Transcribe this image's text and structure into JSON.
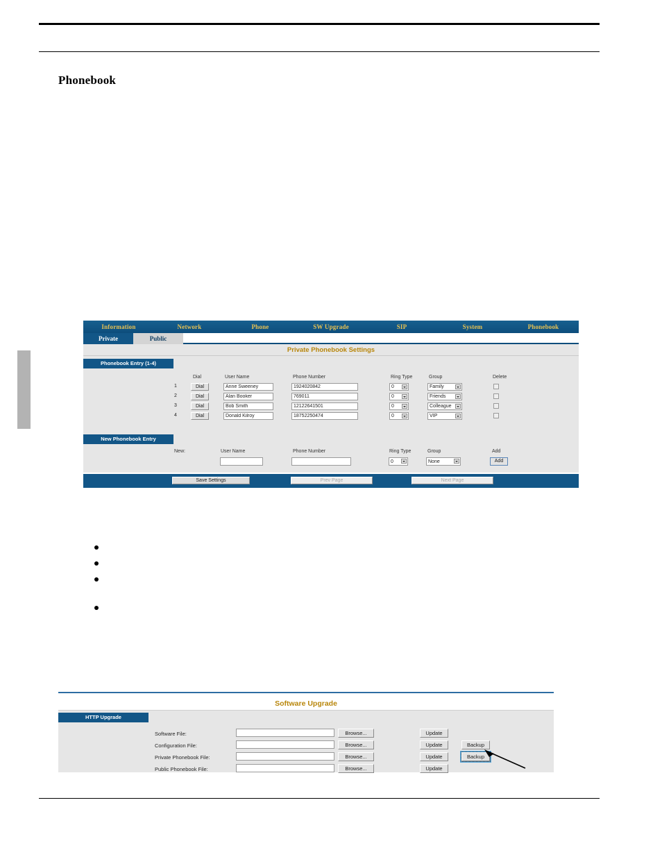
{
  "document": {
    "page_heading": "Phonebook",
    "bullets": [
      "",
      "",
      "",
      ""
    ]
  },
  "phonebook_screenshot": {
    "nav": [
      {
        "label": "Information"
      },
      {
        "label": "Network"
      },
      {
        "label": "Phone"
      },
      {
        "label": "SW Upgrade"
      },
      {
        "label": "SIP"
      },
      {
        "label": "System"
      },
      {
        "label": "Phonebook"
      }
    ],
    "tabs": [
      {
        "label": "Private",
        "active": true
      },
      {
        "label": "Public",
        "active": false
      }
    ],
    "section_title": "Private Phonebook Settings",
    "entry_group_label": "Phonebook Entry (1-4)",
    "columns": {
      "dial": "Dial",
      "user_name": "User Name",
      "phone_number": "Phone Number",
      "ring_type": "Ring Type",
      "group": "Group",
      "delete": "Delete"
    },
    "dial_button_label": "Dial",
    "rows": [
      {
        "index": "1",
        "user_name": "Anne Sweeney",
        "phone_number": "1924020842",
        "ring_type": "0",
        "group": "Family"
      },
      {
        "index": "2",
        "user_name": "Alan Booker",
        "phone_number": "769011",
        "ring_type": "0",
        "group": "Friends"
      },
      {
        "index": "3",
        "user_name": "Bob Smith",
        "phone_number": "12122641501",
        "ring_type": "0",
        "group": "Colleague"
      },
      {
        "index": "4",
        "user_name": "Donald Kilroy",
        "phone_number": "18752250474",
        "ring_type": "0",
        "group": "VIP"
      }
    ],
    "new_entry": {
      "group_label": "New Phonebook Entry",
      "new_label": "New:",
      "user_name_label": "User Name",
      "phone_number_label": "Phone Number",
      "ring_type_label": "Ring Type",
      "group_label_col": "Group",
      "add_label": "Add",
      "user_name_value": "",
      "phone_number_value": "",
      "ring_type_value": "0",
      "group_value": "None",
      "add_button_label": "Add"
    },
    "footer": {
      "save": "Save Settings",
      "prev": "Prev Page",
      "next": "Next Page"
    },
    "colors": {
      "nav_blue": "#125687",
      "nav_text_gold": "#e8c252",
      "panel_gray": "#e6e6e6",
      "title_gold": "#b8860b"
    }
  },
  "upgrade_screenshot": {
    "section_title": "Software Upgrade",
    "group_label": "HTTP Upgrade",
    "browse_label": "Browse...",
    "update_label": "Update",
    "backup_label": "Backup",
    "rows": [
      {
        "label": "Software File:",
        "value": "",
        "has_backup": false
      },
      {
        "label": "Configuration File:",
        "value": "",
        "has_backup": true
      },
      {
        "label": "Private Phonebook File:",
        "value": "",
        "has_backup": true,
        "backup_focused": true
      },
      {
        "label": "Public Phonebook File:",
        "value": "",
        "has_backup": false
      }
    ],
    "annotation": "arrow-pointing-to-private-phonebook-backup"
  }
}
